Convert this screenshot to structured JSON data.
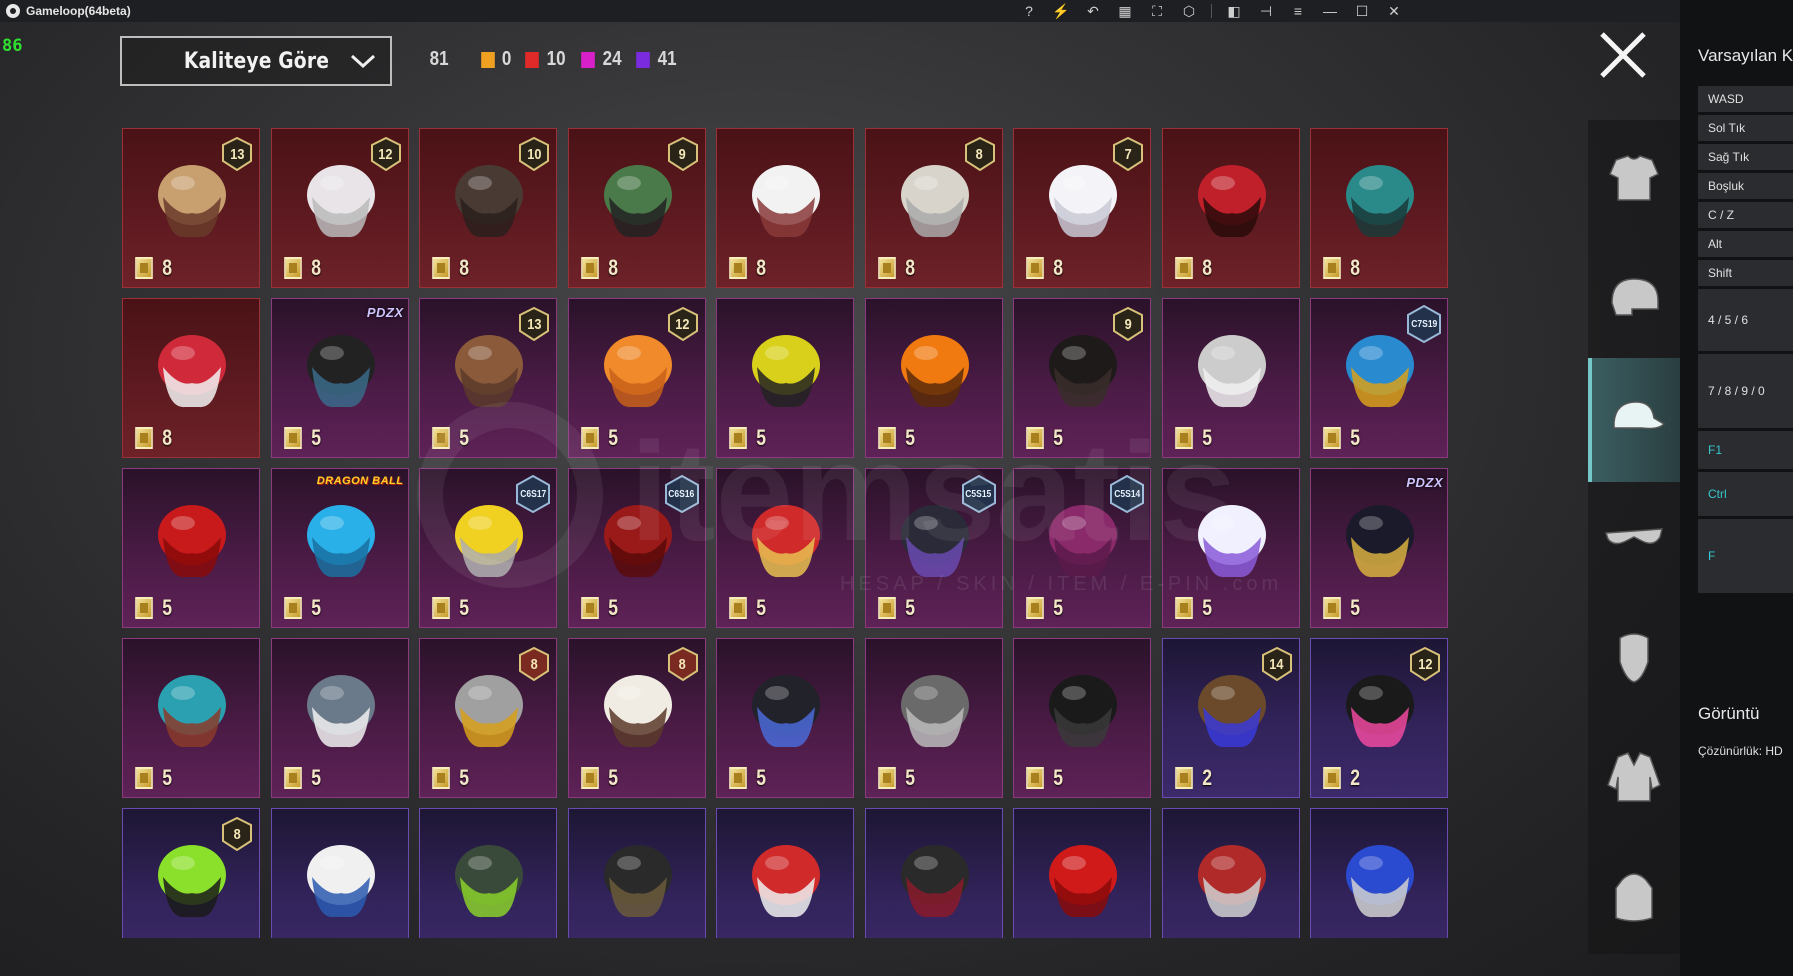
{
  "window": {
    "title": "Gameloop(64beta)"
  },
  "fps": "86",
  "sort_dropdown": {
    "label": "Kaliteye Göre"
  },
  "counts": {
    "total": "81",
    "by_quality": [
      {
        "color": "#f0a020",
        "value": "0"
      },
      {
        "color": "#e02a2a",
        "value": "10"
      },
      {
        "color": "#d820c8",
        "value": "24"
      },
      {
        "color": "#7a2be0",
        "value": "41"
      }
    ]
  },
  "items": [
    {
      "name": "straw-hat-with-hair",
      "quality": "red",
      "price": "8",
      "level": "13"
    },
    {
      "name": "white-long-hair",
      "quality": "red",
      "price": "8",
      "level": "12"
    },
    {
      "name": "dark-braided-hair",
      "quality": "red",
      "price": "8",
      "level": "10"
    },
    {
      "name": "zombie-head-mohawk",
      "quality": "red",
      "price": "8",
      "level": "9"
    },
    {
      "name": "white-cowboy-hat",
      "quality": "red",
      "price": "8"
    },
    {
      "name": "silver-winged-hair",
      "quality": "red",
      "price": "8",
      "level": "8"
    },
    {
      "name": "white-long-ponytail",
      "quality": "red",
      "price": "8",
      "level": "7"
    },
    {
      "name": "red-racing-helmet",
      "quality": "red",
      "price": "8"
    },
    {
      "name": "teal-dragon-helmet",
      "quality": "red",
      "price": "8"
    },
    {
      "name": "fox-mask-helmet",
      "quality": "red",
      "price": "8"
    },
    {
      "name": "black-twin-bun-hair",
      "quality": "pink",
      "price": "5",
      "brand": "PDZX"
    },
    {
      "name": "goggles-aviator-cap",
      "quality": "pink",
      "price": "5",
      "level": "13"
    },
    {
      "name": "orange-twin-tail-hair",
      "quality": "pink",
      "price": "5",
      "level": "12"
    },
    {
      "name": "yellow-wasp-helmet",
      "quality": "pink",
      "price": "5"
    },
    {
      "name": "pumpkin-head",
      "quality": "pink",
      "price": "5"
    },
    {
      "name": "black-long-hair",
      "quality": "pink",
      "price": "5",
      "level": "9"
    },
    {
      "name": "silver-short-hair",
      "quality": "pink",
      "price": "5"
    },
    {
      "name": "feathered-tribal-helmet",
      "quality": "pink",
      "price": "5",
      "season": "C7S19"
    },
    {
      "name": "red-long-hair",
      "quality": "pink",
      "price": "5"
    },
    {
      "name": "blue-spiky-hair",
      "quality": "pink",
      "price": "5",
      "brand": "DRAGON BALL"
    },
    {
      "name": "yellow-visor-grey-hair",
      "quality": "pink",
      "price": "5",
      "season": "C6S17"
    },
    {
      "name": "red-bob-hair",
      "quality": "pink",
      "price": "5",
      "season": "C6S16"
    },
    {
      "name": "dragon-mask-helmet",
      "quality": "pink",
      "price": "5"
    },
    {
      "name": "black-baseball-cap",
      "quality": "pink",
      "price": "5",
      "season": "C5S15"
    },
    {
      "name": "magenta-long-hair",
      "quality": "pink",
      "price": "5",
      "season": "C5S14"
    },
    {
      "name": "unicorn-headphones",
      "quality": "pink",
      "price": "5"
    },
    {
      "name": "gold-black-helmet",
      "quality": "pink",
      "price": "5",
      "brand": "PDZX"
    },
    {
      "name": "robot-tiki-mask",
      "quality": "pink",
      "price": "5"
    },
    {
      "name": "shark-mask",
      "quality": "pink",
      "price": "5"
    },
    {
      "name": "bucket-hat-helmet",
      "quality": "pink",
      "price": "5",
      "level": "8"
    },
    {
      "name": "white-fedora",
      "quality": "pink",
      "price": "5",
      "level": "8"
    },
    {
      "name": "black-full-helmet",
      "quality": "pink",
      "price": "5"
    },
    {
      "name": "wolf-mask",
      "quality": "pink",
      "price": "5"
    },
    {
      "name": "dark-hooded-mask",
      "quality": "pink",
      "price": "5"
    },
    {
      "name": "cat-ear-cap-long-hair",
      "quality": "purple",
      "price": "2",
      "level": "14"
    },
    {
      "name": "bunny-ear-helmet",
      "quality": "purple",
      "price": "2",
      "level": "12"
    },
    {
      "name": "green-skull-hood",
      "quality": "purple",
      "level": "8"
    },
    {
      "name": "white-blue-cap",
      "quality": "purple"
    },
    {
      "name": "green-gas-mask-helmet",
      "quality": "purple"
    },
    {
      "name": "black-motor-helmet",
      "quality": "purple"
    },
    {
      "name": "red-white-cap",
      "quality": "purple"
    },
    {
      "name": "black-bucket-hat",
      "quality": "purple"
    },
    {
      "name": "red-mohawk",
      "quality": "purple"
    },
    {
      "name": "red-cricket-helmet",
      "quality": "purple"
    },
    {
      "name": "blue-cricket-helmet",
      "quality": "purple"
    }
  ],
  "tabs": [
    {
      "name": "outfit",
      "icon": "outfit-icon"
    },
    {
      "name": "helmet",
      "icon": "helmet-icon"
    },
    {
      "name": "hat",
      "icon": "cap-icon",
      "active": true
    },
    {
      "name": "glasses",
      "icon": "glasses-icon"
    },
    {
      "name": "mask",
      "icon": "mask-icon"
    },
    {
      "name": "jacket",
      "icon": "jacket-icon"
    },
    {
      "name": "backpack",
      "icon": "backpack-icon"
    }
  ],
  "panel": {
    "header": "Varsayılan K",
    "keys": [
      {
        "label": "WASD",
        "h": 26
      },
      {
        "label": "Sol Tık",
        "h": 26
      },
      {
        "label": "Sağ Tık",
        "h": 26
      },
      {
        "label": "Boşluk",
        "h": 26
      },
      {
        "label": "C / Z",
        "h": 26
      },
      {
        "label": "Alt",
        "h": 26
      },
      {
        "label": "Shift",
        "h": 26
      },
      {
        "label": "4 / 5 / 6",
        "h": 62
      },
      {
        "label": "7 / 8 / 9 / 0",
        "h": 74
      },
      {
        "label": "F1",
        "h": 38,
        "accent": true
      },
      {
        "label": "Ctrl",
        "h": 44,
        "accent": true
      },
      {
        "label": "F",
        "h": 74,
        "accent": true
      }
    ],
    "display_header": "Görüntü",
    "resolution": "Çözünürlük: HD"
  },
  "watermark": {
    "text": "itemsatis",
    "subtext": "HESAP / SKIN / ITEM / E-PIN .com"
  }
}
